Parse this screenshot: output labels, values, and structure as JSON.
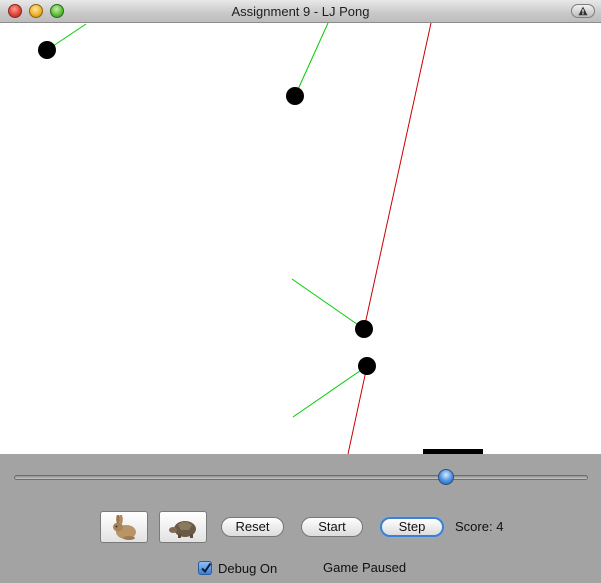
{
  "window": {
    "title": "Assignment 9 - LJ Pong"
  },
  "game": {
    "colors": {
      "ball": "#000000",
      "debug_vector": "#00cc00",
      "trajectory": "#cc0000",
      "paddle": "#000000",
      "background": "#ffffff"
    }
  },
  "controls": {
    "speed_slider_value": 0.75,
    "fast_button_icon": "rabbit-icon",
    "slow_button_icon": "turtle-icon",
    "reset_label": "Reset",
    "start_label": "Start",
    "step_label": "Step",
    "score_label": "Score:",
    "score_value": "4",
    "debug_label": "Debug On",
    "debug_checked": true,
    "status_text": "Game Paused"
  }
}
